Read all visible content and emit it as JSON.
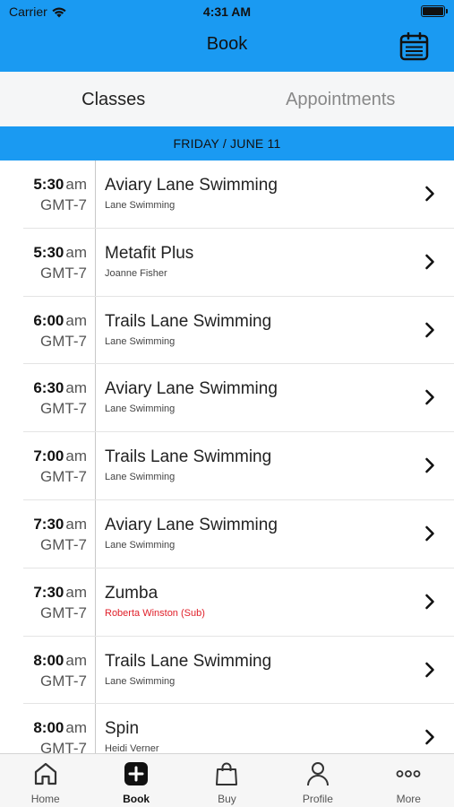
{
  "status_bar": {
    "carrier": "Carrier",
    "time": "4:31 AM"
  },
  "header": {
    "title": "Book",
    "calendar_icon": "calendar-icon"
  },
  "tabs": [
    {
      "label": "Classes",
      "active": true
    },
    {
      "label": "Appointments",
      "active": false
    }
  ],
  "date_header": "FRIDAY / JUNE 11",
  "classes": [
    {
      "time": "5:30",
      "ampm": "am",
      "tz": "GMT-7",
      "name": "Aviary Lane Swimming",
      "sub": "Lane Swimming"
    },
    {
      "time": "5:30",
      "ampm": "am",
      "tz": "GMT-7",
      "name": "Metafit Plus",
      "sub": "Joanne Fisher"
    },
    {
      "time": "6:00",
      "ampm": "am",
      "tz": "GMT-7",
      "name": "Trails Lane Swimming",
      "sub": "Lane Swimming"
    },
    {
      "time": "6:30",
      "ampm": "am",
      "tz": "GMT-7",
      "name": "Aviary Lane Swimming",
      "sub": "Lane Swimming"
    },
    {
      "time": "7:00",
      "ampm": "am",
      "tz": "GMT-7",
      "name": "Trails Lane Swimming",
      "sub": "Lane Swimming"
    },
    {
      "time": "7:30",
      "ampm": "am",
      "tz": "GMT-7",
      "name": "Aviary Lane Swimming",
      "sub": "Lane Swimming"
    },
    {
      "time": "7:30",
      "ampm": "am",
      "tz": "GMT-7",
      "name": "Zumba",
      "sub": "Roberta Winston (Sub)"
    },
    {
      "time": "8:00",
      "ampm": "am",
      "tz": "GMT-7",
      "name": "Trails Lane Swimming",
      "sub": "Lane Swimming"
    },
    {
      "time": "8:00",
      "ampm": "am",
      "tz": "GMT-7",
      "name": "Spin",
      "sub": "Heidi Verner"
    }
  ],
  "bottom_nav": [
    {
      "label": "Home",
      "icon": "home-icon"
    },
    {
      "label": "Book",
      "icon": "book-plus-icon",
      "active": true
    },
    {
      "label": "Buy",
      "icon": "shopping-bag-icon"
    },
    {
      "label": "Profile",
      "icon": "profile-icon"
    },
    {
      "label": "More",
      "icon": "more-dots-icon"
    }
  ],
  "colors": {
    "brand_blue": "#1a9af2",
    "sub_alert": "#e0202a"
  }
}
